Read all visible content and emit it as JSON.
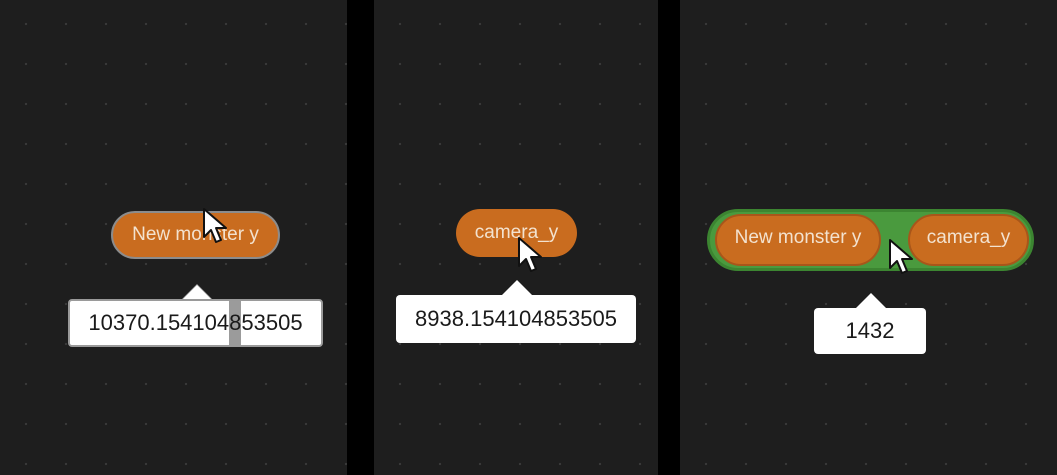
{
  "panels": [
    {
      "reporter_label": "New monster y",
      "result_before_caret": "10370.154104",
      "result_caret_char": "8",
      "result_after_caret": "53505"
    },
    {
      "reporter_label": "camera_y",
      "result": "8938.154104853505"
    },
    {
      "left_reporter_label": "New monster y",
      "right_reporter_label": "camera_y",
      "result": "1432"
    }
  ],
  "colors": {
    "canvas_background": "#1e1e1e",
    "reporter_orange": "#c96c1f",
    "operator_green": "#4a9a3e",
    "bubble_white": "#ffffff"
  },
  "icons": [
    "mouse-pointer-icon"
  ]
}
